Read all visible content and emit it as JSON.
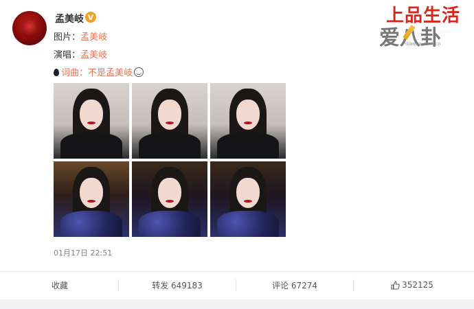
{
  "post": {
    "username": "孟美岐",
    "verified_badge": "V",
    "lines": [
      {
        "label": "图片：",
        "link": "孟美岐"
      },
      {
        "label": "演唱：",
        "link": "孟美岐"
      },
      {
        "label": "词曲：",
        "link": "不是孟美岐"
      }
    ],
    "timestamp": "01月17日 22:51",
    "photos_count": 6
  },
  "actions": {
    "favorite": "收藏",
    "repost": "转发 649183",
    "comment": "评论 67274",
    "like": "352125"
  },
  "watermark": {
    "line1": "上品生活",
    "line2": "爱八卦",
    "line3": "ibaqua.com.cn"
  },
  "icons": [
    "verified-badge-icon",
    "water-drop-icon",
    "laugh-emoji-icon",
    "thumbs-up-icon",
    "pencil-icon"
  ],
  "colors": {
    "link": "#eb7350",
    "badge": "#f6a123",
    "watermark_red": "#d9251c"
  }
}
